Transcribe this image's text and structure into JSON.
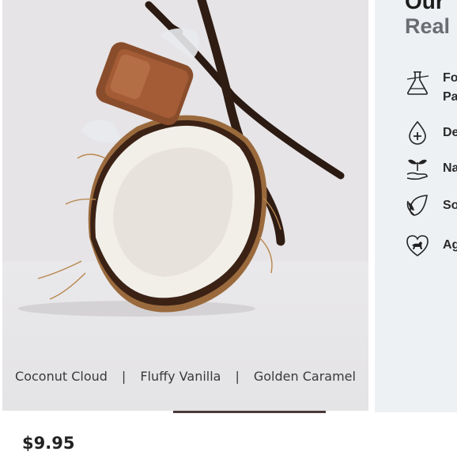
{
  "hero": {
    "scents": [
      "Coconut Cloud",
      "Fluffy Vanilla",
      "Golden Caramel"
    ],
    "separator": "|"
  },
  "info": {
    "heading": "Our",
    "subheading": "Real",
    "features": [
      {
        "icon": "flask-icon",
        "label_line1": "Fo",
        "label_line2": "Pa"
      },
      {
        "icon": "drop-plus-icon",
        "label_line1": "De",
        "label_line2": ""
      },
      {
        "icon": "hand-plant-icon",
        "label_line1": "Na",
        "label_line2": ""
      },
      {
        "icon": "leaf-icon",
        "label_line1": "So",
        "label_line2": ""
      },
      {
        "icon": "heart-dog-icon",
        "label_line1": "Ag",
        "label_line2": ""
      }
    ]
  },
  "product": {
    "price": "$9.95"
  },
  "colors": {
    "hero_bg": "#e6e4e6",
    "info_bg": "#eef1f4",
    "carousel_active": "#4a3a3a"
  }
}
